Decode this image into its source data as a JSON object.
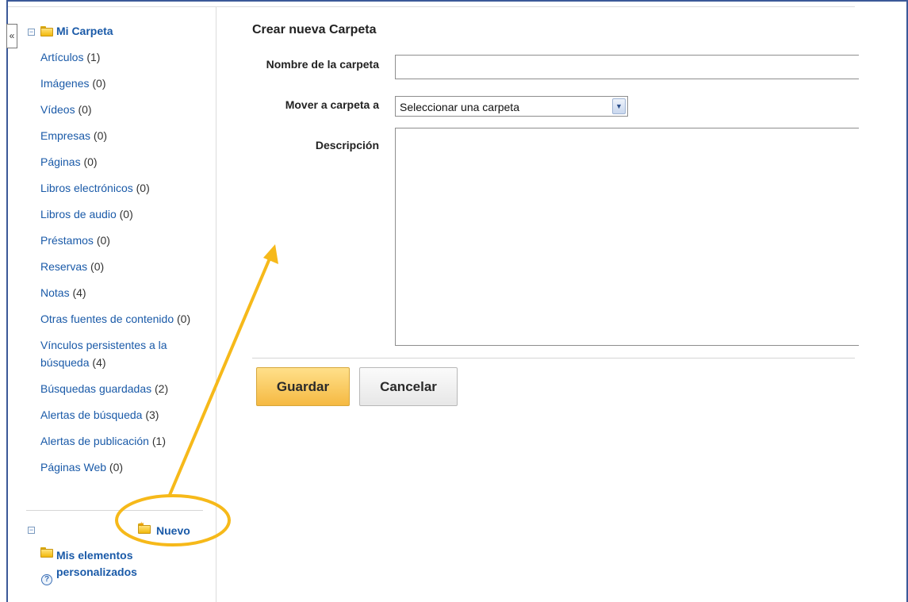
{
  "sidebar": {
    "collapse_glyph": "«",
    "tree_collapsed_glyph": "−",
    "folder_title": "Mi Carpeta",
    "items": [
      {
        "label": "Artículos",
        "count": "(1)"
      },
      {
        "label": "Imágenes",
        "count": "(0)"
      },
      {
        "label": "Vídeos",
        "count": "(0)"
      },
      {
        "label": "Empresas",
        "count": "(0)"
      },
      {
        "label": "Páginas",
        "count": "(0)"
      },
      {
        "label": "Libros electrónicos",
        "count": "(0)"
      },
      {
        "label": "Libros de audio",
        "count": "(0)"
      },
      {
        "label": "Préstamos",
        "count": "(0)"
      },
      {
        "label": "Reservas",
        "count": "(0)"
      },
      {
        "label": "Notas",
        "count": "(4)"
      },
      {
        "label": "Otras fuentes de contenido",
        "count": "(0)"
      },
      {
        "label": "Vínculos persistentes a la búsqueda",
        "count": "(4)"
      },
      {
        "label": "Búsquedas guardadas",
        "count": "(2)"
      },
      {
        "label": "Alertas de búsqueda",
        "count": "(3)"
      },
      {
        "label": "Alertas de publicación",
        "count": "(1)"
      },
      {
        "label": "Páginas Web",
        "count": "(0)"
      }
    ],
    "new_label": "Nuevo",
    "personal_label": "Mis elementos personalizados",
    "help_glyph": "?"
  },
  "form": {
    "title": "Crear nueva Carpeta",
    "name_label": "Nombre de la carpeta",
    "name_value": "",
    "move_label": "Mover a carpeta a",
    "move_selected": "Seleccionar una carpeta",
    "description_label": "Descripción",
    "description_value": "",
    "save_label": "Guardar",
    "cancel_label": "Cancelar"
  },
  "icons": {
    "folder": "folder-icon",
    "new_folder": "new-folder-icon",
    "help": "help-icon",
    "dropdown": "chevron-down-icon"
  },
  "colors": {
    "link": "#1a5aa8",
    "frame": "#3b5998",
    "save_button": "#f5b942",
    "annotation": "#f6b91a"
  }
}
